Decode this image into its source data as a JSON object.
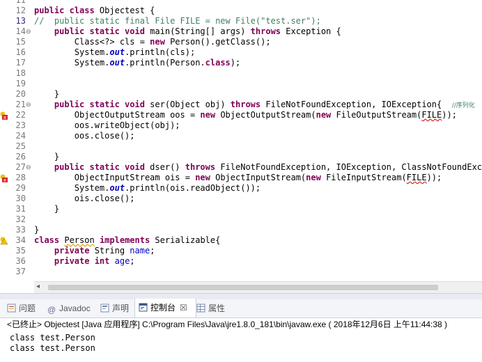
{
  "editor": {
    "lines": [
      {
        "n": "11",
        "html": ""
      },
      {
        "n": "12",
        "html": "<span class=\"kw\">public class</span> Objectest {"
      },
      {
        "n": "13",
        "cur": true,
        "html": "<span class=\"cm\">//  public static final File FILE = new File(\"test.ser\");</span>"
      },
      {
        "n": "14",
        "fold": true,
        "html": "    <span class=\"kw\">public static void</span> main(String[] args) <span class=\"kw\">throws</span> Exception {"
      },
      {
        "n": "15",
        "html": "        Class&lt;?&gt; cls = <span class=\"kw\">new</span> Person().getClass();"
      },
      {
        "n": "16",
        "html": "        System.<span class=\"sf\">out</span>.println(cls);"
      },
      {
        "n": "17",
        "html": "        System.<span class=\"sf\">out</span>.println(Person.<span class=\"kw\">class</span>);"
      },
      {
        "n": "18",
        "html": ""
      },
      {
        "n": "19",
        "html": ""
      },
      {
        "n": "20",
        "html": "    }"
      },
      {
        "n": "21",
        "fold": true,
        "html": "    <span class=\"kw\">public static void</span> ser(Object obj) <span class=\"kw\">throws</span> FileNotFoundException, IOException{  <span class=\"cm-small\">//序列化</span>"
      },
      {
        "n": "22",
        "mark": "error",
        "html": "        ObjectOutputStream oos = <span class=\"kw\">new</span> ObjectOutputStream(<span class=\"kw\">new</span> FileOutputStream(<span class=\"err\">FILE</span>));"
      },
      {
        "n": "23",
        "html": "        oos.writeObject(obj);"
      },
      {
        "n": "24",
        "html": "        oos.close();"
      },
      {
        "n": "25",
        "html": ""
      },
      {
        "n": "26",
        "html": "    }"
      },
      {
        "n": "27",
        "fold": true,
        "html": "    <span class=\"kw\">public static void</span> dser() <span class=\"kw\">throws</span> FileNotFoundException, IOException, ClassNotFoundException"
      },
      {
        "n": "28",
        "mark": "error",
        "html": "        ObjectInputStream ois = <span class=\"kw\">new</span> ObjectInputStream(<span class=\"kw\">new</span> FileInputStream(<span class=\"err\">FILE</span>));"
      },
      {
        "n": "29",
        "html": "        System.<span class=\"sf\">out</span>.println(ois.readObject());"
      },
      {
        "n": "30",
        "html": "        ois.close();"
      },
      {
        "n": "31",
        "html": "    }"
      },
      {
        "n": "32",
        "html": ""
      },
      {
        "n": "33",
        "html": "}"
      },
      {
        "n": "34",
        "mark": "warn",
        "html": "<span class=\"kw\">class</span> <span class=\"warn\">Person</span> <span class=\"kw\">implements</span> Serializable{"
      },
      {
        "n": "35",
        "html": "    <span class=\"kw\">private</span> String <span class=\"fld\">name</span>;"
      },
      {
        "n": "36",
        "html": "    <span class=\"kw\">private int</span> <span class=\"fld\">age</span>;"
      },
      {
        "n": "37",
        "html": ""
      }
    ]
  },
  "tabs": [
    {
      "id": "problems",
      "label": "问题",
      "icon": "problems-icon"
    },
    {
      "id": "javadoc",
      "label": "Javadoc",
      "icon": "at-icon"
    },
    {
      "id": "declaration",
      "label": "声明",
      "icon": "declaration-icon"
    },
    {
      "id": "console",
      "label": "控制台",
      "icon": "console-icon",
      "active": true,
      "close": "☒"
    },
    {
      "id": "properties",
      "label": "属性",
      "icon": "properties-icon"
    }
  ],
  "console": {
    "header": "<已终止> Objectest [Java 应用程序] C:\\Program Files\\Java\\jre1.8.0_181\\bin\\javaw.exe ( 2018年12月6日 上午11:44:38 )",
    "output": [
      "class test.Person",
      "class test.Person"
    ]
  }
}
